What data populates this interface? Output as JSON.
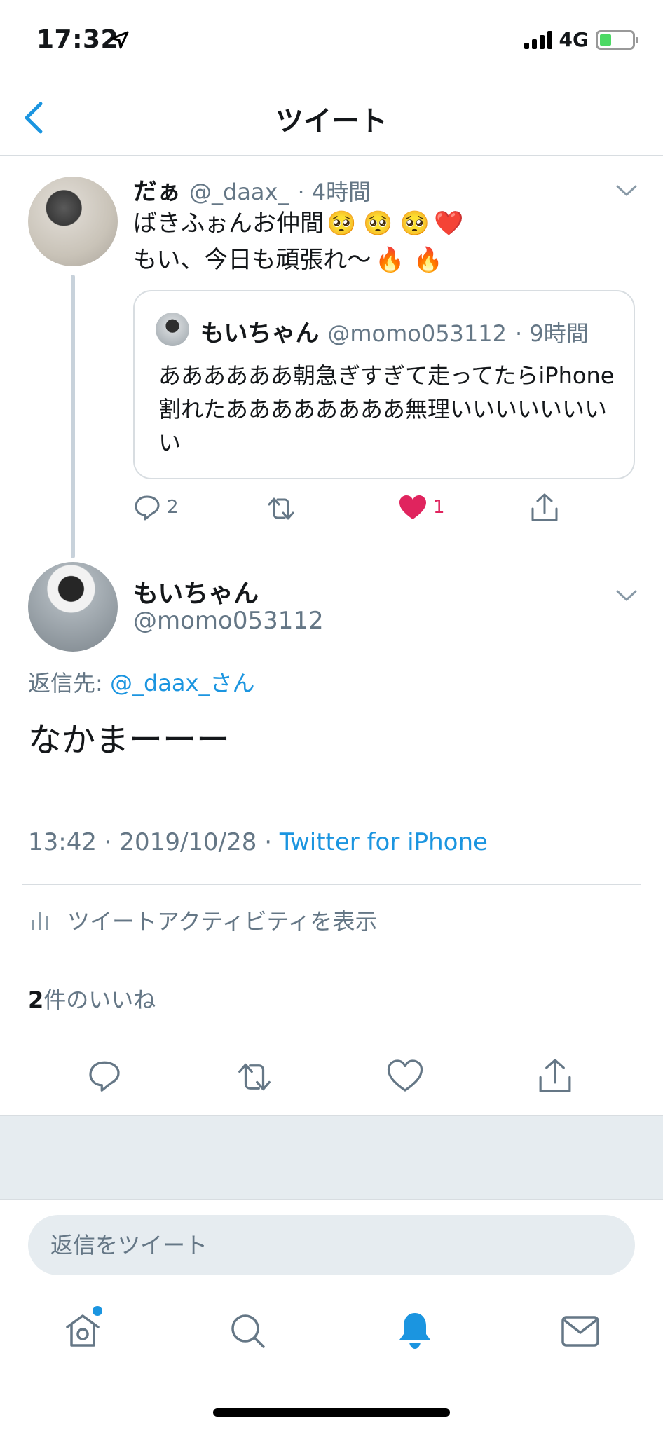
{
  "status": {
    "time": "17:32",
    "network": "4G"
  },
  "header": {
    "title": "ツイート"
  },
  "parent_tweet": {
    "name": "だぁ",
    "handle": "@_daax_",
    "age": "· 4時間",
    "line1": "ばきふぉんお仲間",
    "line2": "もい、今日も頑張れ〜",
    "emoji_line1": [
      "🥺",
      "🥺",
      "🥺",
      "❤️"
    ],
    "emoji_line2": [
      "🔥",
      "🔥"
    ],
    "quoted": {
      "name": "もいちゃん",
      "handle": "@momo053112",
      "age": "· 9時間",
      "text": "ああああああ朝急ぎすぎて走ってたらiPhone割れたああああああああ無理いいいいいいいい"
    },
    "reply_count": "2",
    "like_count": "1"
  },
  "main_tweet": {
    "name": "もいちゃん",
    "handle": "@momo053112",
    "reply_to_label": "返信先:",
    "reply_to_user": "@_daax_さん",
    "text": "なかまーーー",
    "time": "13:42",
    "date": "2019/10/28",
    "source": "Twitter for iPhone",
    "activity_label": "ツイートアクティビティを表示",
    "likes_count": "2",
    "likes_label": "件のいいね"
  },
  "reply_box": {
    "placeholder": "返信をツイート"
  },
  "colors": {
    "accent": "#1b95e0",
    "like": "#e0245e",
    "icon_gray": "#657786"
  }
}
